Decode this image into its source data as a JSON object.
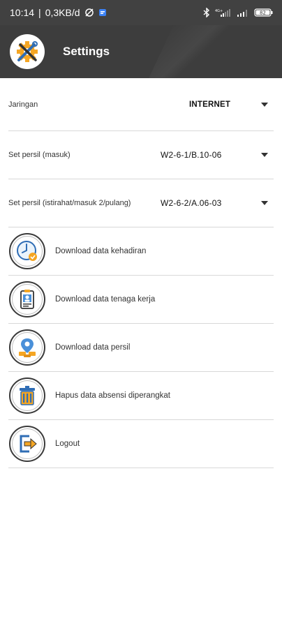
{
  "status_bar": {
    "time": "10:14",
    "separator": "|",
    "speed": "0,3KB/d",
    "battery": "82"
  },
  "app_bar": {
    "title": "Settings",
    "logo_icon": "settings-tools-icon"
  },
  "settings": [
    {
      "label": "Jaringan",
      "value": "INTERNET"
    },
    {
      "label": "Set persil (masuk)",
      "value": "W2-6-1/B.10-06"
    },
    {
      "label": "Set persil (istirahat/masuk 2/pulang)",
      "value": "W2-6-2/A.06-03"
    }
  ],
  "menu": [
    {
      "label": "Download data kehadiran",
      "icon": "clock-check-icon"
    },
    {
      "label": "Download data tenaga kerja",
      "icon": "id-card-icon"
    },
    {
      "label": "Download data persil",
      "icon": "map-pin-icon"
    },
    {
      "label": "Hapus data absensi diperangkat",
      "icon": "trash-icon"
    },
    {
      "label": "Logout",
      "icon": "logout-icon"
    }
  ],
  "colors": {
    "status_bar": "#414141",
    "app_bar": "#3d3d3d",
    "accent_orange": "#f5a623",
    "accent_blue": "#4a90d9",
    "divider": "#d8d8d8"
  }
}
